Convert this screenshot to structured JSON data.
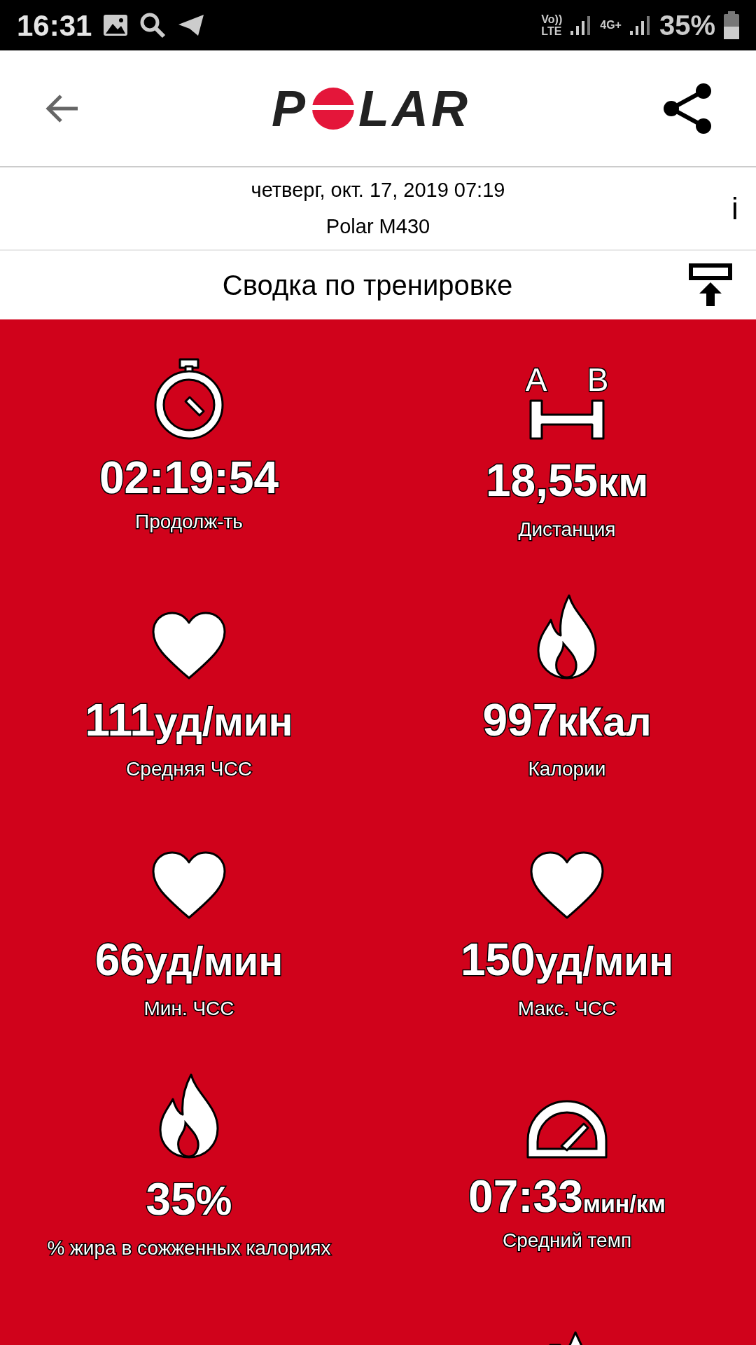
{
  "status_bar": {
    "time": "16:31",
    "volte": [
      "Vo))",
      "LTE"
    ],
    "network": "4G+",
    "battery": "35%"
  },
  "header": {
    "logo": {
      "before": "P",
      "after": "LAR"
    }
  },
  "session": {
    "date": "четверг, окт. 17, 2019 07:19",
    "device": "Polar M430",
    "info": "i"
  },
  "section_title": "Сводка по тренировке",
  "distance_icon_points": [
    "A",
    "B"
  ],
  "metrics": [
    {
      "kind": "stopwatch",
      "value": "02:19:54",
      "label": "Продолж-ть"
    },
    {
      "kind": "distance",
      "value": "18,55",
      "unit": "км",
      "label": "Дистанция"
    },
    {
      "kind": "heart",
      "value": "111",
      "unit": "уд/мин",
      "label": "Средняя ЧСС"
    },
    {
      "kind": "flame",
      "value": "997",
      "unit": "кКал",
      "label": "Калории"
    },
    {
      "kind": "heart",
      "value": "66",
      "unit": "уд/мин",
      "label": "Мин. ЧСС"
    },
    {
      "kind": "heart",
      "value": "150",
      "unit": "уд/мин",
      "label": "Макс. ЧСС"
    },
    {
      "kind": "flame",
      "value": "35",
      "unit": "%",
      "label": "% жира в сожженных калориях"
    },
    {
      "kind": "pace",
      "value": "07:33",
      "unit": "мин/км",
      "label": "Средний темп"
    },
    {
      "kind": "blank"
    },
    {
      "kind": "ascent"
    }
  ]
}
